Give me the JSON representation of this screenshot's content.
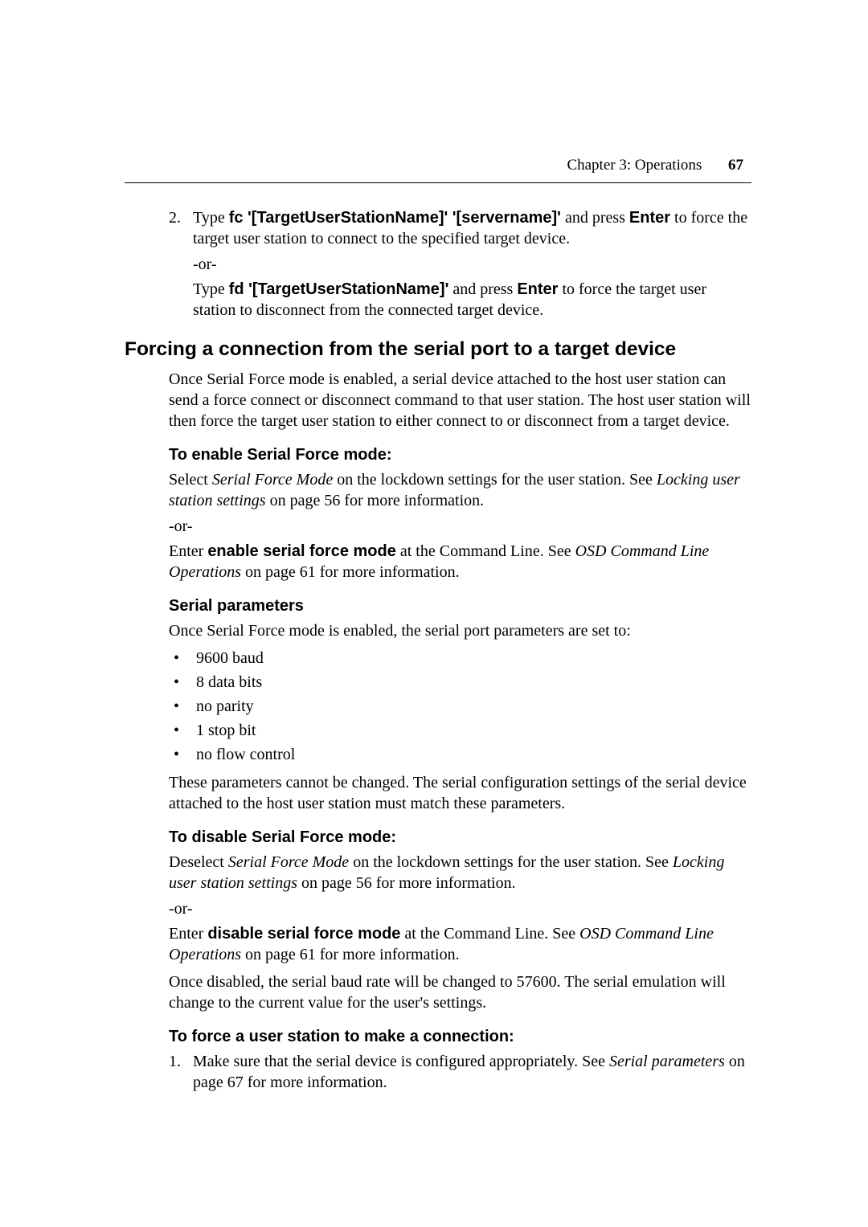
{
  "header": {
    "chapter": "Chapter 3: Operations",
    "page": "67"
  },
  "step2": {
    "num": "2.",
    "line1_a": "Type ",
    "line1_cmd": "fc '[TargetUserStationName]' '[servername]'",
    "line1_b": " and press ",
    "line1_enter": "Enter",
    "line1_c": " to force the target user station to connect to the specified target device.",
    "or": "-or-",
    "line2_a": "Type ",
    "line2_cmd": "fd '[TargetUserStationName]'",
    "line2_b": " and press ",
    "line2_enter": "Enter",
    "line2_c": " to force the target user station to disconnect from the connected target device."
  },
  "section_title": "Forcing a connection from the serial port to a target device",
  "intro": "Once Serial Force mode is enabled, a serial device attached to the host user station can send a force connect or disconnect command to that user station. The host user station will then force the target user station to either connect to or disconnect from a target device.",
  "enable": {
    "head": "To enable Serial Force mode:",
    "p1_a": "Select ",
    "p1_i": "Serial Force Mode",
    "p1_b": " on the lockdown settings for the user station. See ",
    "p1_i2": "Locking user station settings",
    "p1_c": " on page 56 for more information.",
    "or": "-or-",
    "p2_a": "Enter ",
    "p2_cmd": "enable serial force mode",
    "p2_b": " at the Command Line. See ",
    "p2_i": "OSD Command Line Operations",
    "p2_c": " on page 61 for more information."
  },
  "serial": {
    "head": "Serial parameters",
    "intro": "Once Serial Force mode is enabled, the serial port parameters are set to:",
    "b1": "9600 baud",
    "b2": "8 data bits",
    "b3": "no parity",
    "b4": "1 stop bit",
    "b5": "no flow control",
    "after": "These parameters cannot be changed. The serial configuration settings of the serial device attached to the host user station must match these parameters."
  },
  "disable": {
    "head": "To disable Serial Force mode:",
    "p1_a": "Deselect ",
    "p1_i": "Serial Force Mode",
    "p1_b": " on the lockdown settings for the user station. See ",
    "p1_i2": "Locking user station settings",
    "p1_c": " on page 56 for more information.",
    "or": "-or-",
    "p2_a": "Enter ",
    "p2_cmd": "disable serial force mode",
    "p2_b": " at the Command Line. See ",
    "p2_i": "OSD Command Line Operations",
    "p2_c": " on page 61 for more information.",
    "p3": "Once disabled, the serial baud rate will be changed to 57600. The serial emulation will change to the current value for the user's settings."
  },
  "force": {
    "head": "To force a user station to make a connection:",
    "num": "1.",
    "p_a": "Make sure that the serial device is configured appropriately. See ",
    "p_i": "Serial parameters",
    "p_b": " on page 67 for more information."
  }
}
